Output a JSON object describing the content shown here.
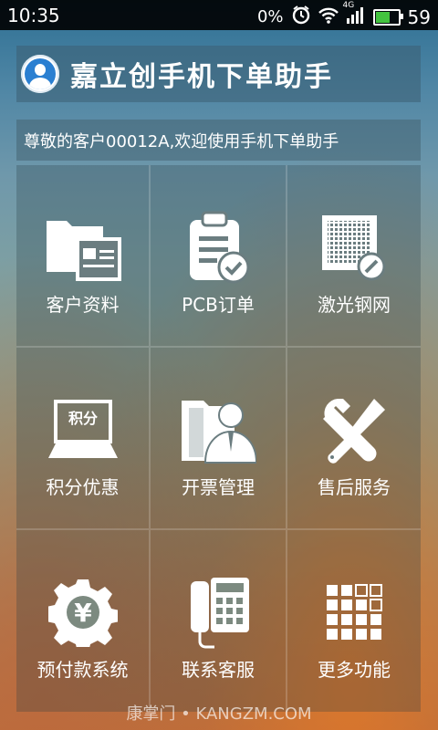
{
  "status_bar": {
    "time": "10:35",
    "data_rate": "0%",
    "network": "4G",
    "battery": "59"
  },
  "header": {
    "title": "嘉立创手机下单助手"
  },
  "welcome": {
    "text": "尊敬的客户00012A,欢迎使用手机下单助手"
  },
  "menu": [
    {
      "label": "客户资料",
      "icon": "folder-card-icon"
    },
    {
      "label": "PCB订单",
      "icon": "clipboard-check-icon"
    },
    {
      "label": "激光钢网",
      "icon": "stencil-mesh-icon"
    },
    {
      "label": "积分优惠",
      "icon": "points-laptop-icon",
      "icon_text": "积分"
    },
    {
      "label": "开票管理",
      "icon": "invoice-person-icon"
    },
    {
      "label": "售后服务",
      "icon": "tools-icon"
    },
    {
      "label": "预付款系统",
      "icon": "yuan-gear-icon",
      "icon_text": "¥"
    },
    {
      "label": "联系客服",
      "icon": "phone-icon"
    },
    {
      "label": "更多功能",
      "icon": "grid-more-icon"
    }
  ],
  "watermark": "康掌门 • KANGZM.COM",
  "colors": {
    "battery_fill": "#43c33f",
    "avatar_blue": "#2a7fd1"
  }
}
